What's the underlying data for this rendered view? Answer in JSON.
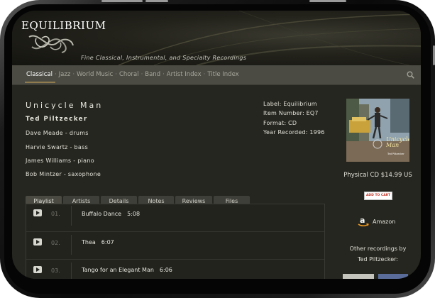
{
  "header": {
    "logo": "EQUILIBRIUM",
    "tagline": "Fine Classical, Instrumental, and Specialty Recordings"
  },
  "nav": {
    "items": [
      "Classical",
      "Jazz",
      "World Music",
      "Choral",
      "Band",
      "Artist Index",
      "Title Index"
    ],
    "active": "Classical"
  },
  "album": {
    "title": "Unicycle Man",
    "artist": "Ted Piltzecker",
    "musicians": [
      "Dave Meade - drums",
      "Harvie Swartz - bass",
      "James Williams - piano",
      "Bob Mintzer - saxophone"
    ]
  },
  "meta": {
    "label": "Label: Equilibrium",
    "item_number": "Item Number: EQ7",
    "format": "Format: CD",
    "year": "Year Recorded: 1996"
  },
  "cover": {
    "title_line1": "Unicycle",
    "title_line2": "Man",
    "artist": "Ted Piltzecker"
  },
  "purchase": {
    "price": "Physical CD $14.99 US",
    "add_to_cart": "ADD TO CART",
    "amazon": "Amazon",
    "other_line1": "Other recordings by",
    "other_line2": "Ted Piltzecker:"
  },
  "tabs": [
    "Playlist",
    "Artists",
    "Details",
    "Notes",
    "Reviews",
    "Files"
  ],
  "tracks": [
    {
      "num": "01.",
      "title": "Buffalo Dance",
      "duration": "5:08"
    },
    {
      "num": "02.",
      "title": "Thea",
      "duration": "6:07"
    },
    {
      "num": "03.",
      "title": "Tango for an Elegant Man",
      "duration": "6:06"
    }
  ],
  "colors": {
    "page_bg": "#262620",
    "nav_bg": "#4b4b44",
    "accent": "#8f7b4e",
    "text": "#e0e0d8"
  }
}
